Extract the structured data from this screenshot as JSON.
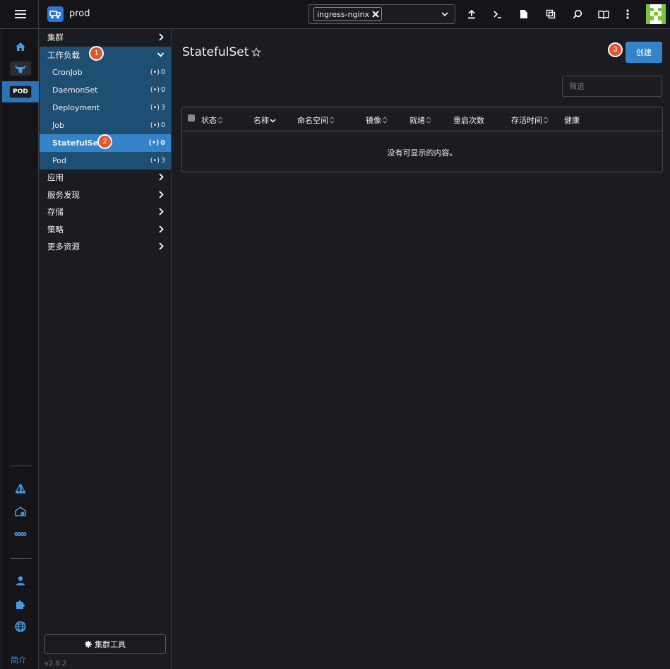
{
  "header": {
    "cluster_name": "prod",
    "namespace_chip": "ingress-nginx",
    "icons": [
      "upload-icon",
      "terminal-icon",
      "file-icon",
      "copy-icon",
      "search-icon",
      "book-icon",
      "more-vertical-icon"
    ]
  },
  "rail": {
    "pod_badge": "POD",
    "bottom_label": "简介"
  },
  "nav": {
    "groups": [
      {
        "label": "集群"
      },
      {
        "label": "工作负载"
      },
      {
        "label": "应用"
      },
      {
        "label": "服务发现"
      },
      {
        "label": "存储"
      },
      {
        "label": "策略"
      },
      {
        "label": "更多资源"
      }
    ],
    "workloads": [
      {
        "label": "CronJob",
        "count": "0"
      },
      {
        "label": "DaemonSet",
        "count": "0"
      },
      {
        "label": "Deployment",
        "count": "3"
      },
      {
        "label": "Job",
        "count": "0"
      },
      {
        "label": "StatefulSet",
        "count": "0"
      },
      {
        "label": "Pod",
        "count": "3"
      }
    ],
    "cluster_tools": "集群工具",
    "version": "v2.8.2"
  },
  "steps": [
    "1",
    "2",
    "3"
  ],
  "main": {
    "title": "StatefulSet",
    "create_label": "创建",
    "filter_placeholder": "筛选",
    "columns": [
      "状态",
      "名称",
      "命名空间",
      "镜像",
      "就绪",
      "重启次数",
      "存活时间",
      "健康"
    ],
    "empty_message": "没有可显示的内容。"
  },
  "colors": {
    "accent": "#3584c9",
    "nav_open_bg": "#1f4e73",
    "step_badge": "#e0562f",
    "background": "#1b1c21"
  }
}
